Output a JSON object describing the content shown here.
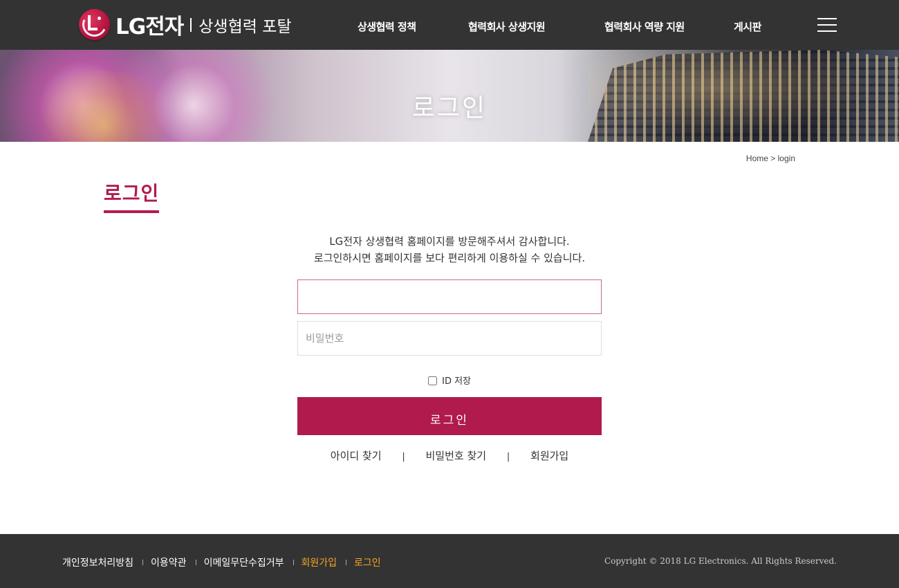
{
  "header": {
    "logo_brand": "LG전자",
    "logo_sub": "상생협력 포탈",
    "nav": [
      {
        "label": "상생협력 정책"
      },
      {
        "label": "협력회사 상생지원"
      },
      {
        "label": "협력회사 역량 지원"
      },
      {
        "label": "게시판"
      }
    ],
    "menu_icon": "hamburger-icon"
  },
  "banner": {
    "title": "로그인"
  },
  "breadcrumb": {
    "home": "Home",
    "sep": ">",
    "current": "login"
  },
  "page": {
    "title": "로그인",
    "welcome_line1": "LG전자 상생협력 홈페이지를 방문해주셔서 감사합니다.",
    "welcome_line2": "로그인하시면 홈페이지를 보다 편리하게 이용하실 수 있습니다."
  },
  "form": {
    "id_value": "",
    "id_placeholder": "",
    "password_placeholder": "비밀번호",
    "save_id_label": "ID 저장",
    "save_id_checked": false,
    "login_button": "로그인",
    "links": {
      "find_id": "아이디 찾기",
      "find_password": "비밀번호 찾기",
      "join": "회원가입",
      "separator": "|"
    }
  },
  "footer": {
    "links": [
      {
        "label": "개인정보처리방침"
      },
      {
        "label": "이용약관"
      },
      {
        "label": "이메일무단수집거부"
      },
      {
        "label": "회원가입"
      },
      {
        "label": "로그인"
      }
    ],
    "copyright": "Copyright © 2018 LG Electronics. All Rights Reserved."
  },
  "colors": {
    "brand": "#b01a4c",
    "header_bg": "#333333",
    "footer_highlight": "#f5a623"
  }
}
